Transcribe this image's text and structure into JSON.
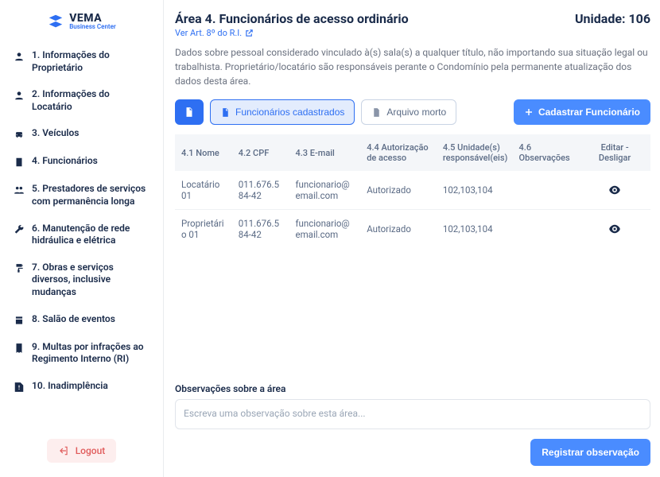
{
  "brand": {
    "name": "VEMA",
    "tagline": "Business Center"
  },
  "sidebar": {
    "items": [
      {
        "label": "1.  Informações do Proprietário"
      },
      {
        "label": "2.  Informações do Locatário"
      },
      {
        "label": "3.  Veículos"
      },
      {
        "label": "4.  Funcionários"
      },
      {
        "label": "5.  Prestadores de serviços com permanência longa"
      },
      {
        "label": "6.  Manutenção de rede hidráulica e elétrica"
      },
      {
        "label": "7.  Obras e serviços diversos, inclusive mudanças"
      },
      {
        "label": "8.  Salão de eventos"
      },
      {
        "label": "9.  Multas por infrações ao Regimento Interno (RI)"
      },
      {
        "label": "10.  Inadimplência"
      }
    ],
    "logout": "Logout"
  },
  "header": {
    "title": "Área  4. Funcionários de acesso ordinário",
    "unit_label": "Unidade: 106",
    "ref_link": "Ver Art. 8º do R.I.",
    "description": "Dados sobre pessoal considerado vinculado à(s) sala(s) a qualquer título, não importando sua situação legal ou trabalhista. Proprietário/locatário são responsáveis perante o Condomínio pela permanente atualização dos dados desta área."
  },
  "toolbar": {
    "registered": "Funcionários cadastrados",
    "archived": "Arquivo morto",
    "add": "Cadastrar Funcionário"
  },
  "table": {
    "headers": [
      "4.1 Nome",
      "4.2 CPF",
      "4.3 E-mail",
      "4.4 Autorização de acesso",
      "4.5 Unidade(s) responsável(eis)",
      "4.6 Observações",
      "Editar - Desligar"
    ],
    "rows": [
      {
        "nome": "Locatário 01",
        "cpf": "011.676.584-42",
        "email": "funcionario@email.com",
        "auth": "Autorizado",
        "unidades": "102,103,104",
        "obs": ""
      },
      {
        "nome": "Proprietário 01",
        "cpf": "011.676.584-42",
        "email": "funcionario@email.com",
        "auth": "Autorizado",
        "unidades": "102,103,104",
        "obs": ""
      }
    ]
  },
  "observations": {
    "label": "Observações sobre a área",
    "placeholder": "Escreva uma observação sobre esta área...",
    "button": "Registrar observação"
  }
}
